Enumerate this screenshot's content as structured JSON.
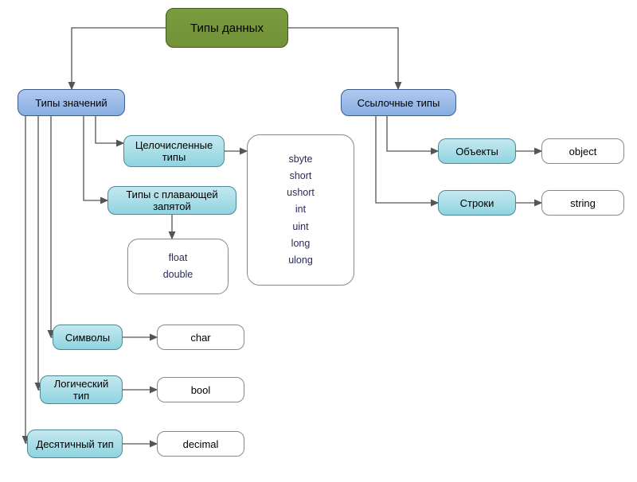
{
  "root": {
    "label": "Типы данных"
  },
  "value_types": {
    "label": "Типы значений"
  },
  "ref_types": {
    "label": "Ссылочные типы"
  },
  "integer_types": {
    "label": "Целочисленные типы"
  },
  "float_types": {
    "label": "Типы с плавающей запятой"
  },
  "symbols": {
    "label": "Символы"
  },
  "logical": {
    "label": "Логический тип"
  },
  "decimal": {
    "label": "Десятичный тип"
  },
  "objects": {
    "label": "Объекты"
  },
  "strings": {
    "label": "Строки"
  },
  "int_list": [
    "sbyte",
    "short",
    "ushort",
    "int",
    "uint",
    "long",
    "ulong"
  ],
  "float_list": [
    "float",
    "double"
  ],
  "char_val": "char",
  "bool_val": "bool",
  "decimal_val": "decimal",
  "object_val": "object",
  "string_val": "string"
}
